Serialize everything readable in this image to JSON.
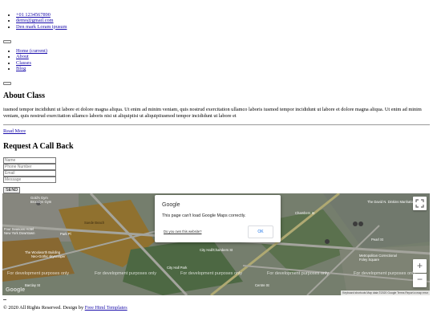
{
  "contact": {
    "phone": "+01 1234567890",
    "email": "demo@gmail.com",
    "address": "Den mark Loram ipusum"
  },
  "nav": {
    "items": [
      "Home (current)",
      "About",
      "Classes",
      "Blog"
    ]
  },
  "about": {
    "title": "About Class",
    "text": "iusmod tempor incididunt ut labore et dolore magna aliqua. Ut enim ad minim veniam, quis nostrud exercitation ullamco laboris iusmod tempor incididunt ut labore et dolore magna aliqua. Ut enim ad minim veniam, quis nostrud exercitation ullamco laboris nisi ut aliquipiisi ut aliquipiiusmod tempor incididunt ut labore et",
    "read_more": "Read More"
  },
  "call_back": {
    "title": "Request A Call Back",
    "name_placeholder": "Name",
    "phone_placeholder": "Phone Number",
    "email_placeholder": "Email",
    "message_placeholder": "Message",
    "send_label": "SEND"
  },
  "map": {
    "dialog_brand": "Google",
    "dialog_message": "This page can't load Google Maps correctly.",
    "dialog_link": "Do you own this website?",
    "dialog_ok": "OK",
    "watermark": "For development purposes only",
    "zoom_in": "+",
    "zoom_out": "−",
    "logo": "Google",
    "attribution": "Keyboard shortcuts   Map data ©2020 Google   Terms   Report a map error",
    "labels": {
      "gym": "Gold's Gym",
      "gym_sub": "Brooklyn Gym",
      "suede": "Suede Beach",
      "four_seasons": "Four Seasons Hotel",
      "four_seasons_sub": "New York Downtown",
      "woolworth": "The Woolworth Building",
      "woolworth_sub": "Neo-Gothic skyscraper",
      "park": "Park Pl",
      "barclay": "Barclay St",
      "city_hall": "City Hall Park",
      "city_hall_station": "City Hall/Chambers St",
      "chambers": "Chambers St",
      "david_n": "The David N. Dinkins Manhattan",
      "pearl": "Pearl St",
      "centre": "Centre St",
      "prison": "Metropolitan Correctional",
      "foley": "Foley Square"
    }
  },
  "footer": {
    "copyright": "© 2020 All Rights Reserved. Design by ",
    "link": "Free Html Templates"
  }
}
